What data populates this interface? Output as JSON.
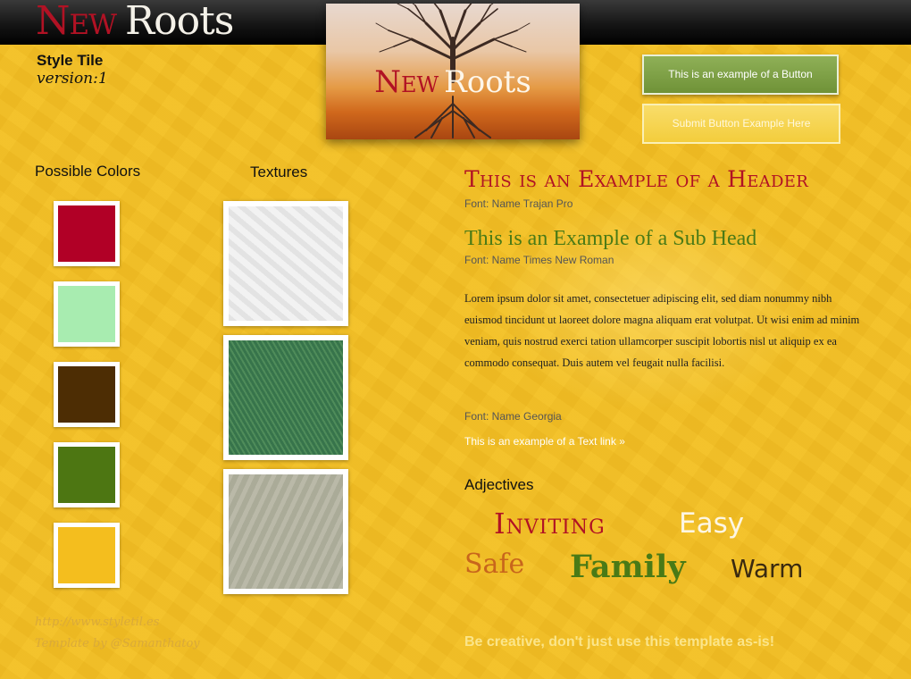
{
  "brand": {
    "logo_word1": "New",
    "logo_word2": "Roots"
  },
  "tile": {
    "title": "Style Tile",
    "version": "version:1"
  },
  "hero_logo": {
    "word1": "New",
    "word2": "Roots"
  },
  "buttons": {
    "primary": "This is an example of a Button",
    "submit": "Submit Button Example Here"
  },
  "colors_section": {
    "title": "Possible Colors",
    "swatches": [
      "#b10026",
      "#a8ecb0",
      "#4d2d04",
      "#4d7612",
      "#f4be1e"
    ]
  },
  "textures_section": {
    "title": "Textures"
  },
  "type": {
    "header_example": "This is an Example of a Header",
    "header_font": "Font: Name Trajan Pro",
    "subhead_example": "This is an Example of a Sub Head",
    "subhead_font": "Font: Name Times New Roman",
    "body": "Lorem ipsum dolor sit amet, consectetuer adipiscing elit, sed diam nonummy nibh euismod tincidunt ut laoreet dolore magna aliquam erat volutpat. Ut wisi enim ad minim veniam, quis nostrud exerci tation ullamcorper suscipit lobortis nisl ut aliquip ex ea commodo consequat. Duis autem vel feugait nulla facilisi.",
    "body_font": "Font: Name Georgia",
    "text_link": "This is an example of a Text link »"
  },
  "adjectives": {
    "title": "Adjectives",
    "inviting": "Inviting",
    "easy": "Easy",
    "safe": "Safe",
    "family": "Family",
    "warm": "Warm"
  },
  "footer": {
    "url": "http://www.styletil.es",
    "template_by": "Template by @Samanthatoy",
    "creative_note": "Be creative, don't just use this template as-is!"
  }
}
